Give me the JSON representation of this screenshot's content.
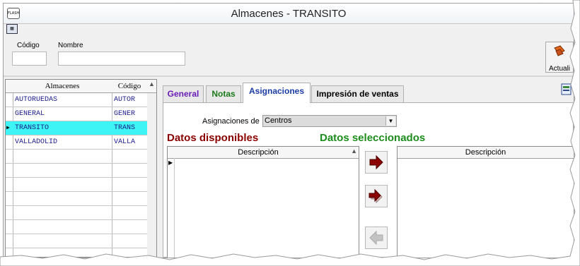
{
  "window": {
    "title": "Almacenes - TRANSITO"
  },
  "header": {
    "codigo_label": "Código",
    "nombre_label": "Nombre",
    "codigo_value": "",
    "nombre_value": "",
    "refresh_label": "Actuali"
  },
  "warehouses": {
    "columns": [
      "Almacenes",
      "Código"
    ],
    "rows": [
      {
        "name": "AUTORUEDAS",
        "code": "AUTOR"
      },
      {
        "name": "GENERAL",
        "code": "GENER"
      },
      {
        "name": "TRANSITO",
        "code": "TRANS",
        "selected": true
      },
      {
        "name": "VALLADOLID",
        "code": "VALLA"
      }
    ]
  },
  "tabs": [
    {
      "label": "General",
      "color": "#6a1bb8"
    },
    {
      "label": "Notas",
      "color": "#1b7a1b"
    },
    {
      "label": "Asignaciones",
      "active": true,
      "color": "#1a3ca8"
    },
    {
      "label": "Impresión de ventas",
      "color": "#000000"
    }
  ],
  "assignments": {
    "combo_label": "Asignaciones de",
    "combo_value": "Centros",
    "available_title": "Datos disponibles",
    "selected_title": "Datos seleccionados",
    "available_header": "Descripción",
    "selected_header": "Descripción"
  },
  "colors": {
    "selected_row": "#3ef4f4",
    "available_title": "#8b0000",
    "selected_title": "#1c8c1c",
    "arrow": "#8b0000"
  },
  "icons": {
    "app": "app-logo-icon",
    "export": "export-icon",
    "refresh": "refresh-icon",
    "move_right": "arrow-right-icon",
    "move_all_right": "double-arrow-right-icon",
    "move_left": "arrow-left-icon"
  }
}
